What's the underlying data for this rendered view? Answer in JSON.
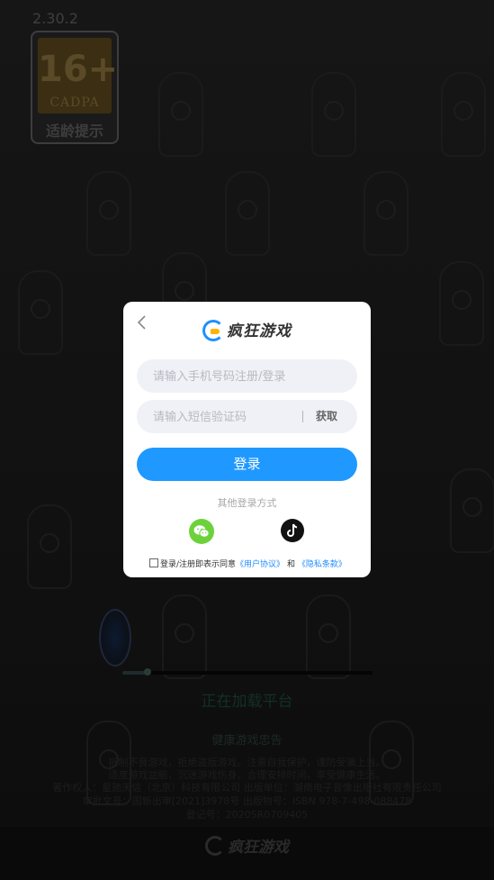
{
  "app": {
    "version": "2.30.2"
  },
  "age_rating": {
    "number": "16+",
    "org": "CADPA",
    "label": "适龄提示"
  },
  "loading": {
    "text": "正在加载平台",
    "progress": 0.1
  },
  "health_notice": {
    "title": "健康游戏忠告",
    "lines": [
      "抵制不良游戏，拒绝盗版游戏。注意自我保护，谨防受骗上当。",
      "适度游戏益脑，沉迷游戏伤身。合理安排时间，享受健康生活。",
      "著作权人：星驰天信（北京）科技有限公司  出版单位：湖南电子音像出版社有限责任公司",
      "审批文号：国新出审[2021]3978号  出版物号：ISBN 978-7-498-088478",
      "登记号：2020SR0709405"
    ]
  },
  "footer": {
    "brand": "疯狂游戏"
  },
  "dialog": {
    "brand": "疯狂游戏",
    "phone_placeholder": "请输入手机号码注册/登录",
    "code_placeholder": "请输入短信验证码",
    "get_code_label": "获取",
    "login_label": "登录",
    "other_methods_label": "其他登录方式",
    "agreement": {
      "prefix": "登录/注册即表示同意",
      "user_agreement": "《用户协议》",
      "and": "和",
      "privacy": "《隐私条款》"
    },
    "social": [
      "wechat-icon",
      "tiktok-icon"
    ]
  },
  "colors": {
    "accent": "#1f99ff",
    "wechat": "#6cd23b"
  }
}
